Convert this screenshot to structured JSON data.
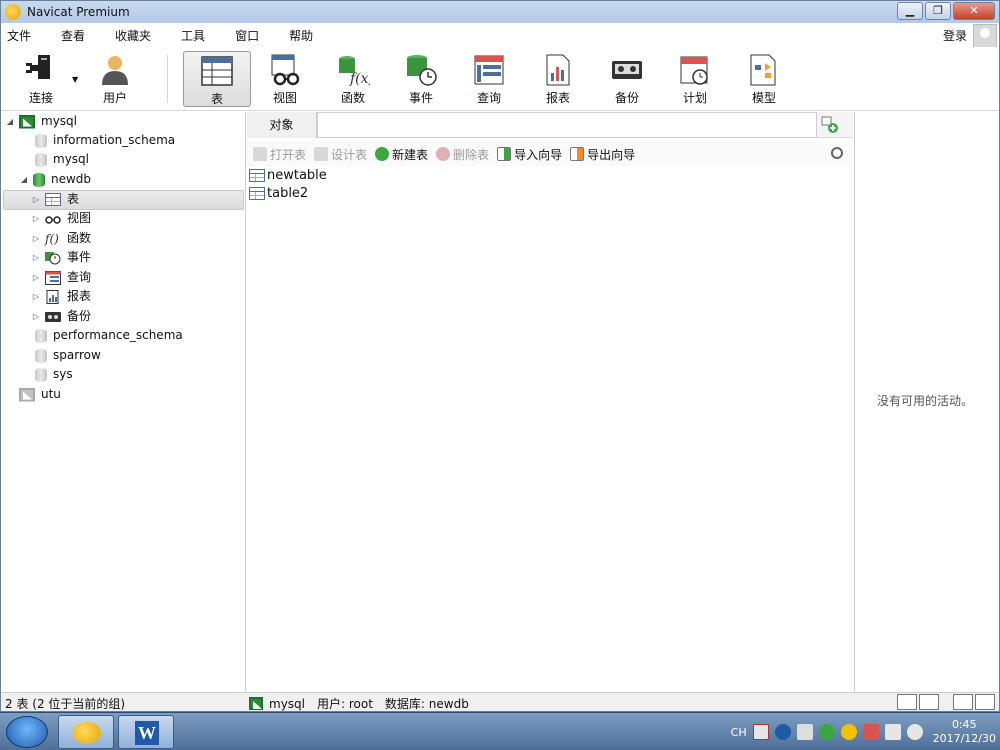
{
  "window": {
    "title": "Navicat Premium"
  },
  "menu": [
    "文件",
    "查看",
    "收藏夹",
    "工具",
    "窗口",
    "帮助"
  ],
  "login_label": "登录",
  "toolbar": [
    {
      "label": "连接",
      "icon": "plug-icon"
    },
    {
      "label": "用户",
      "icon": "user-icon"
    },
    {
      "label": "表",
      "icon": "table-icon",
      "active": true
    },
    {
      "label": "视图",
      "icon": "view-glasses-icon"
    },
    {
      "label": "函数",
      "icon": "function-icon"
    },
    {
      "label": "事件",
      "icon": "event-icon"
    },
    {
      "label": "查询",
      "icon": "query-icon"
    },
    {
      "label": "报表",
      "icon": "report-icon"
    },
    {
      "label": "备份",
      "icon": "backup-icon"
    },
    {
      "label": "计划",
      "icon": "schedule-icon"
    },
    {
      "label": "模型",
      "icon": "model-icon"
    }
  ],
  "tree": {
    "connections": [
      {
        "name": "mysql",
        "expanded": true,
        "databases": [
          "information_schema",
          "mysql",
          "newdb",
          "performance_schema",
          "sparrow",
          "sys"
        ]
      },
      {
        "name": "utu",
        "expanded": false
      }
    ],
    "newdb_children": [
      "表",
      "视图",
      "函数",
      "事件",
      "查询",
      "报表",
      "备份"
    ]
  },
  "object_tab": "对象",
  "object_toolbar": [
    {
      "label": "打开表",
      "disabled": true
    },
    {
      "label": "设计表",
      "disabled": true
    },
    {
      "label": "新建表",
      "disabled": false
    },
    {
      "label": "删除表",
      "disabled": true
    },
    {
      "label": "导入向导",
      "disabled": false
    },
    {
      "label": "导出向导",
      "disabled": false
    }
  ],
  "objects": [
    "newtable",
    "table2"
  ],
  "right_pane": {
    "message": "没有可用的活动。"
  },
  "status": {
    "left": "2 表 (2 位于当前的组)",
    "connection": "mysql",
    "user": "用户: root",
    "database": "数据库: newdb"
  },
  "tray": {
    "lang": "CH",
    "time": "0:45",
    "date": "2017/12/30"
  },
  "colors": {
    "accent_green": "#2f8a37",
    "selection": "#dcdcdc"
  }
}
